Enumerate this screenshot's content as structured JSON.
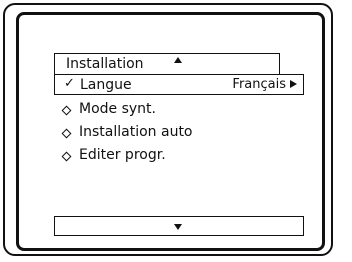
{
  "menu": {
    "title": "Installation",
    "up_icon": "up-arrow-icon",
    "selected_item": {
      "icon": "check-icon",
      "check_symbol": "✓",
      "label": "Langue",
      "value": "Français",
      "value_icon": "right-arrow-icon"
    },
    "items": [
      {
        "label": "Mode synt.",
        "icon": "diamond-icon"
      },
      {
        "label": "Installation auto",
        "icon": "diamond-icon"
      },
      {
        "label": "Editer progr.",
        "icon": "diamond-icon"
      }
    ],
    "down_icon": "down-arrow-icon"
  }
}
